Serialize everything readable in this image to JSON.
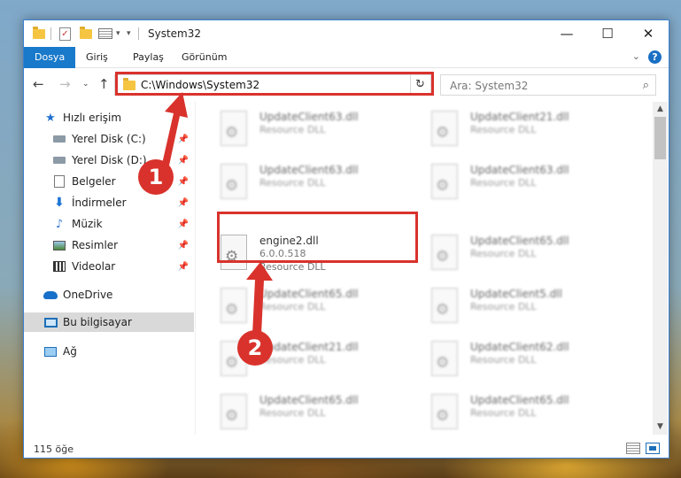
{
  "window": {
    "title": "System32"
  },
  "ribbon": {
    "tabs": [
      "Dosya",
      "Giriş",
      "Paylaş",
      "Görünüm"
    ]
  },
  "address": {
    "path": "C:\\Windows\\System32"
  },
  "search": {
    "placeholder": "Ara: System32"
  },
  "sidebar": {
    "quick_access": "Hızlı erişim",
    "items": [
      "Yerel Disk (C:)",
      "Yerel Disk (D:)",
      "Belgeler",
      "İndirmeler",
      "Müzik",
      "Resimler",
      "Videolar"
    ],
    "onedrive": "OneDrive",
    "this_pc": "Bu bilgisayar",
    "network": "Ağ"
  },
  "files": {
    "highlighted": {
      "name": "engine2.dll",
      "version": "6.0.0.518",
      "type": "Resource DLL"
    },
    "left": [
      {
        "name": "UpdateClient63.dll",
        "type": "Resource DLL"
      },
      {
        "name": "UpdateClient63.dll",
        "type": "Resource DLL"
      },
      {
        "name": "UpdateClient65.dll",
        "type": "Resource DLL"
      },
      {
        "name": "UpdateClient21.dll",
        "type": "Resource DLL"
      },
      {
        "name": "UpdateClient65.dll",
        "type": "Resource DLL"
      }
    ],
    "right": [
      {
        "name": "UpdateClient21.dll",
        "type": "Resource DLL"
      },
      {
        "name": "UpdateClient63.dll",
        "type": "Resource DLL"
      },
      {
        "name": "UpdateClient65.dll",
        "type": "Resource DLL"
      },
      {
        "name": "UpdateClient5.dll",
        "type": "Resource DLL"
      },
      {
        "name": "UpdateClient62.dll",
        "type": "Resource DLL"
      },
      {
        "name": "UpdateClient65.dll",
        "type": "Resource DLL"
      }
    ]
  },
  "status": {
    "count": "115 öğe"
  },
  "annotations": {
    "step1": "1",
    "step2": "2"
  },
  "colors": {
    "highlight": "#d9322c",
    "accent": "#1979ca"
  }
}
